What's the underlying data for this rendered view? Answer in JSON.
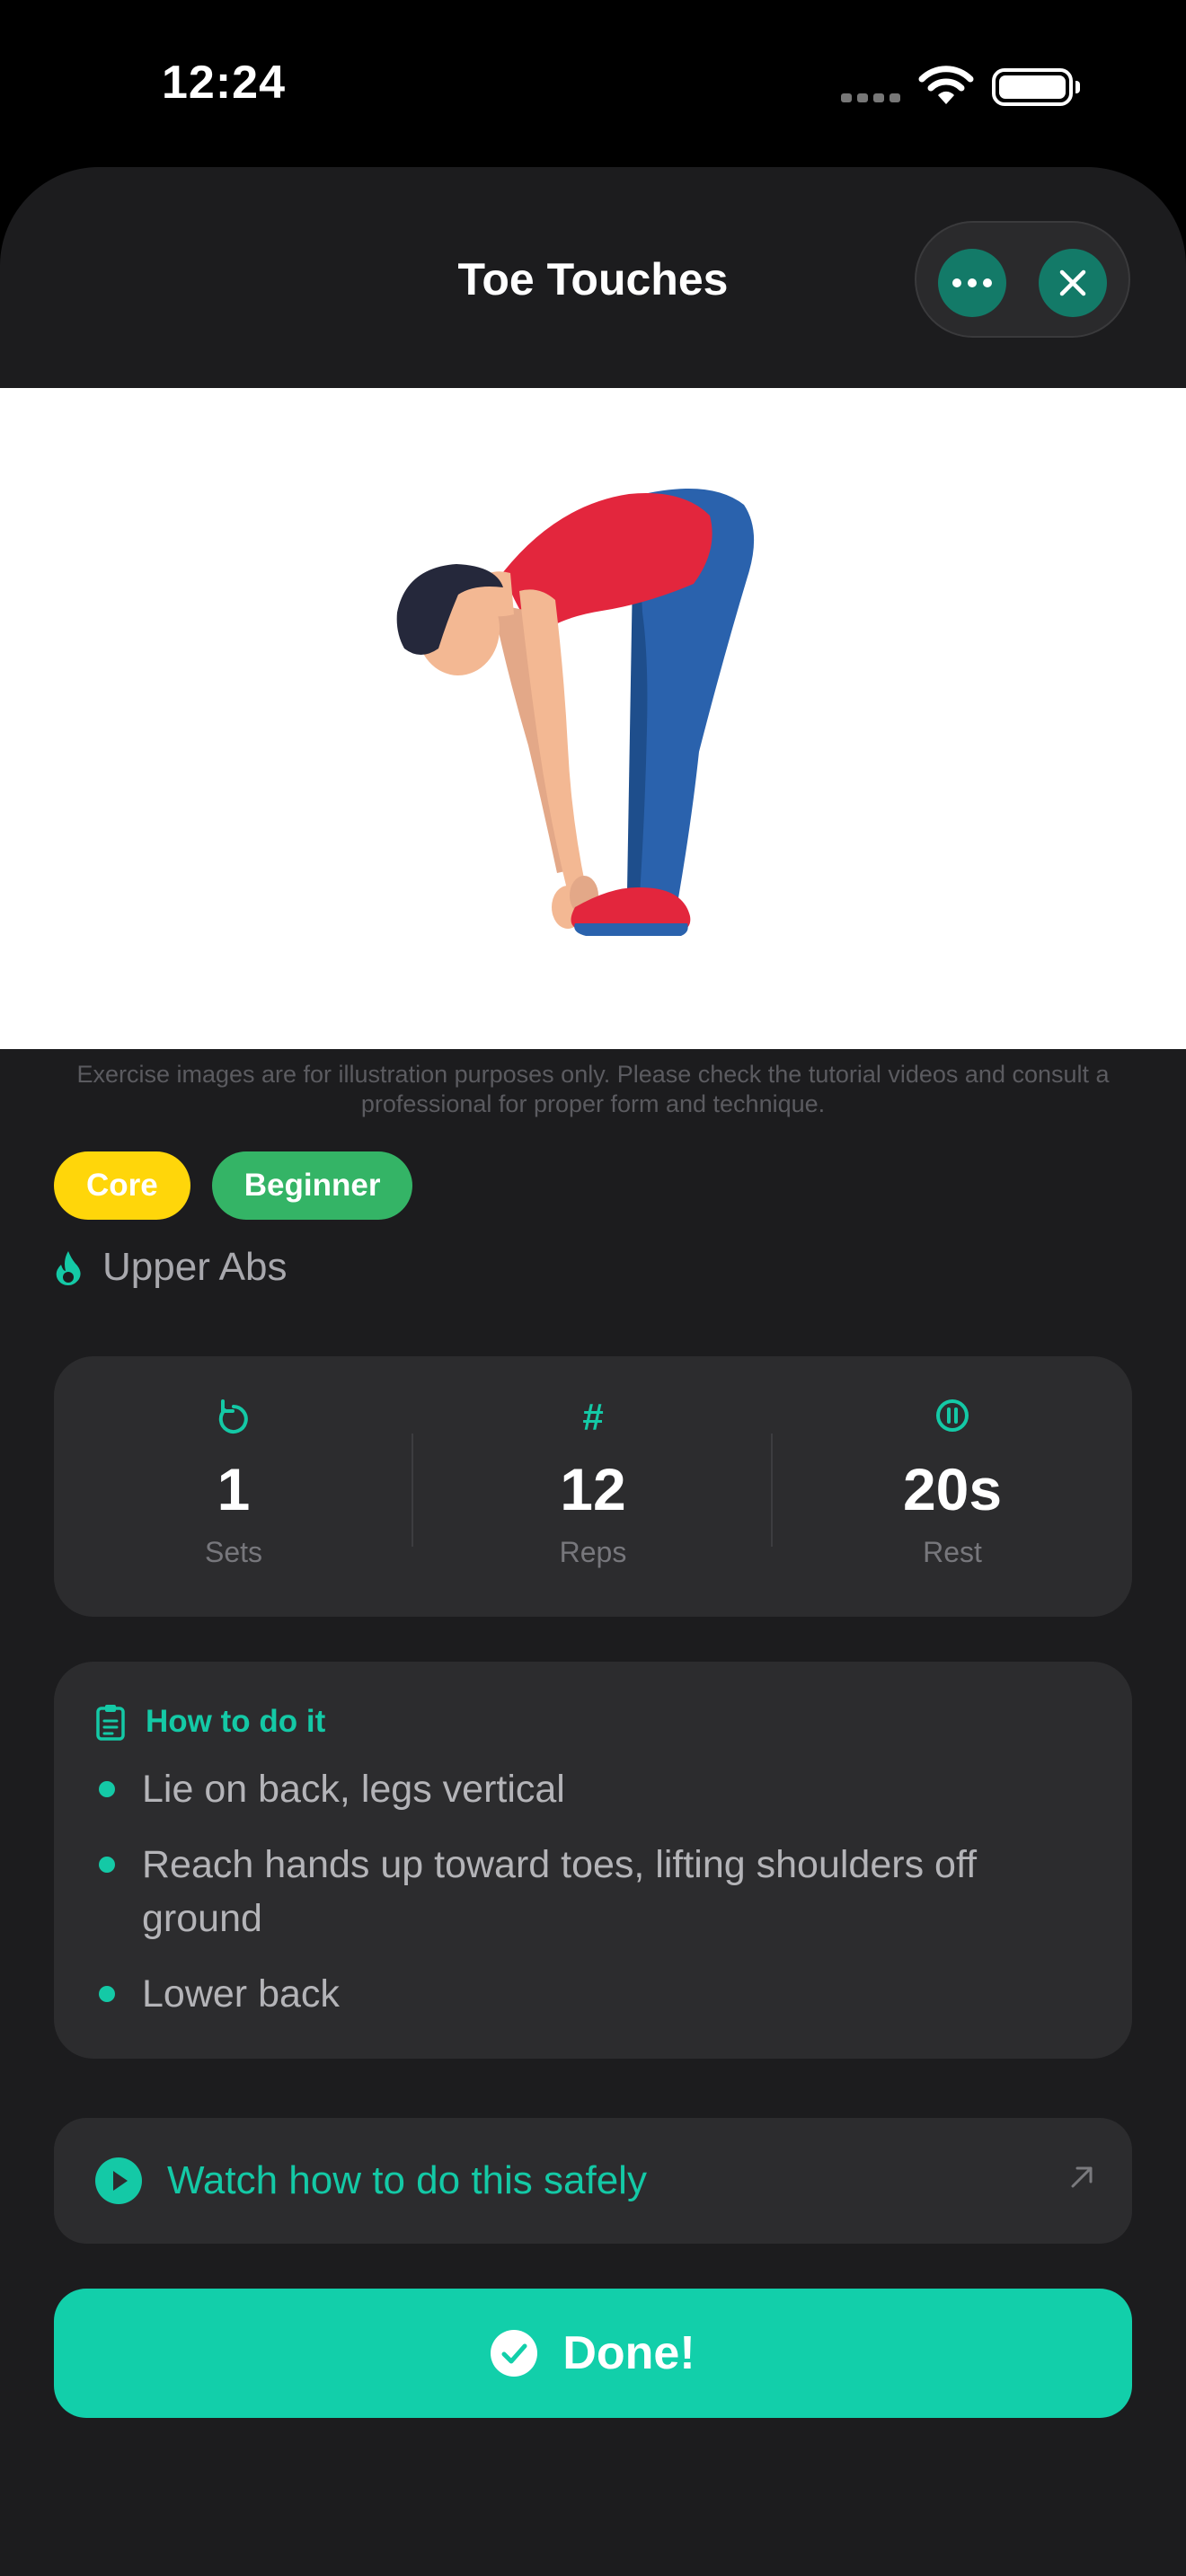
{
  "status_bar": {
    "time": "12:24"
  },
  "header": {
    "title": "Toe Touches"
  },
  "hero": {
    "disclaimer": "Exercise images are for illustration purposes only. Please check the tutorial videos and consult a professional for proper form and technique."
  },
  "tags": [
    {
      "label": "Core",
      "color": "#FFD60A"
    },
    {
      "label": "Beginner",
      "color": "#34B466"
    }
  ],
  "target_muscle": {
    "label": "Upper Abs",
    "icon": "flame-icon"
  },
  "stats": [
    {
      "icon": "repeat-icon",
      "value": "1",
      "label": "Sets"
    },
    {
      "icon": "hash-icon",
      "value": "12",
      "label": "Reps"
    },
    {
      "icon": "pause-icon",
      "value": "20s",
      "label": "Rest"
    }
  ],
  "howto": {
    "title": "How to do it",
    "steps": [
      "Lie on back, legs vertical",
      "Reach hands up toward toes, lifting shoulders off ground",
      "Lower back"
    ]
  },
  "watch": {
    "label": "Watch how to do this safely"
  },
  "done": {
    "label": "Done!"
  },
  "colors": {
    "accent": "#14C9A6",
    "background": "#1C1C1E",
    "card": "#2C2C2E",
    "done_button": "#12CFAA"
  }
}
